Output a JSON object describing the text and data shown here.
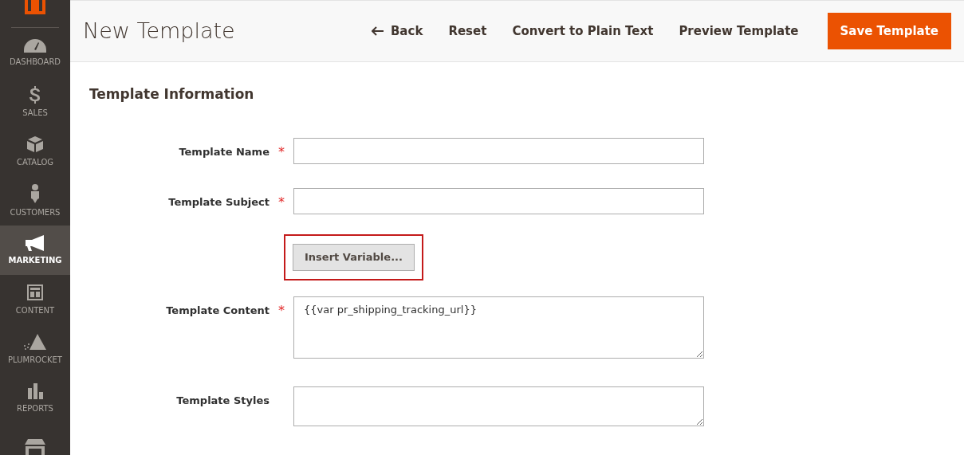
{
  "sidebar": {
    "items": [
      {
        "kind": "dashboard",
        "label": "DASHBOARD",
        "selected": false
      },
      {
        "kind": "sales",
        "label": "SALES",
        "selected": false
      },
      {
        "kind": "catalog",
        "label": "CATALOG",
        "selected": false
      },
      {
        "kind": "customers",
        "label": "CUSTOMERS",
        "selected": false
      },
      {
        "kind": "marketing",
        "label": "MARKETING",
        "selected": true
      },
      {
        "kind": "content",
        "label": "CONTENT",
        "selected": false
      },
      {
        "kind": "plumrocket",
        "label": "PLUMROCKET",
        "selected": false
      },
      {
        "kind": "reports",
        "label": "REPORTS",
        "selected": false
      },
      {
        "kind": "stores",
        "selected": false
      }
    ]
  },
  "header": {
    "title": "New Template",
    "actions": [
      {
        "kind": "back",
        "label": "Back"
      },
      {
        "kind": "link",
        "label": "Reset"
      },
      {
        "kind": "link",
        "label": "Convert to Plain Text"
      },
      {
        "kind": "link",
        "label": "Preview Template"
      },
      {
        "kind": "primary",
        "label": "Save Template"
      }
    ]
  },
  "section": {
    "title": "Template Information",
    "fields": [
      {
        "kind": "input",
        "label": "Template Name",
        "required_mark": "*"
      },
      {
        "kind": "input",
        "label": "Template Subject",
        "required_mark": "*"
      },
      {
        "kind": "button",
        "label": "Insert Variable...",
        "highlighted": true
      },
      {
        "kind": "textarea",
        "label": "Template Content",
        "required_mark": "*",
        "value": "{{var pr_shipping_tracking_url}}"
      },
      {
        "kind": "textarea",
        "label": "Template Styles"
      }
    ]
  }
}
